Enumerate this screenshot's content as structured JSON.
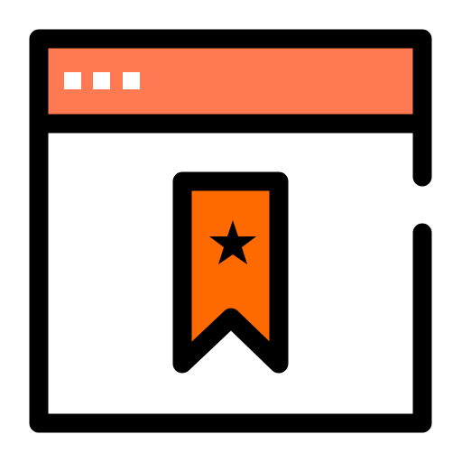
{
  "icon": {
    "name": "bookmarked-webpage-icon",
    "colors": {
      "stroke": "#000000",
      "title_bar": "#FF7A52",
      "window_body": "#FFFFFF",
      "bookmark": "#FF6A00",
      "window_dots": "#FFFFFF",
      "star": "#000000"
    }
  }
}
